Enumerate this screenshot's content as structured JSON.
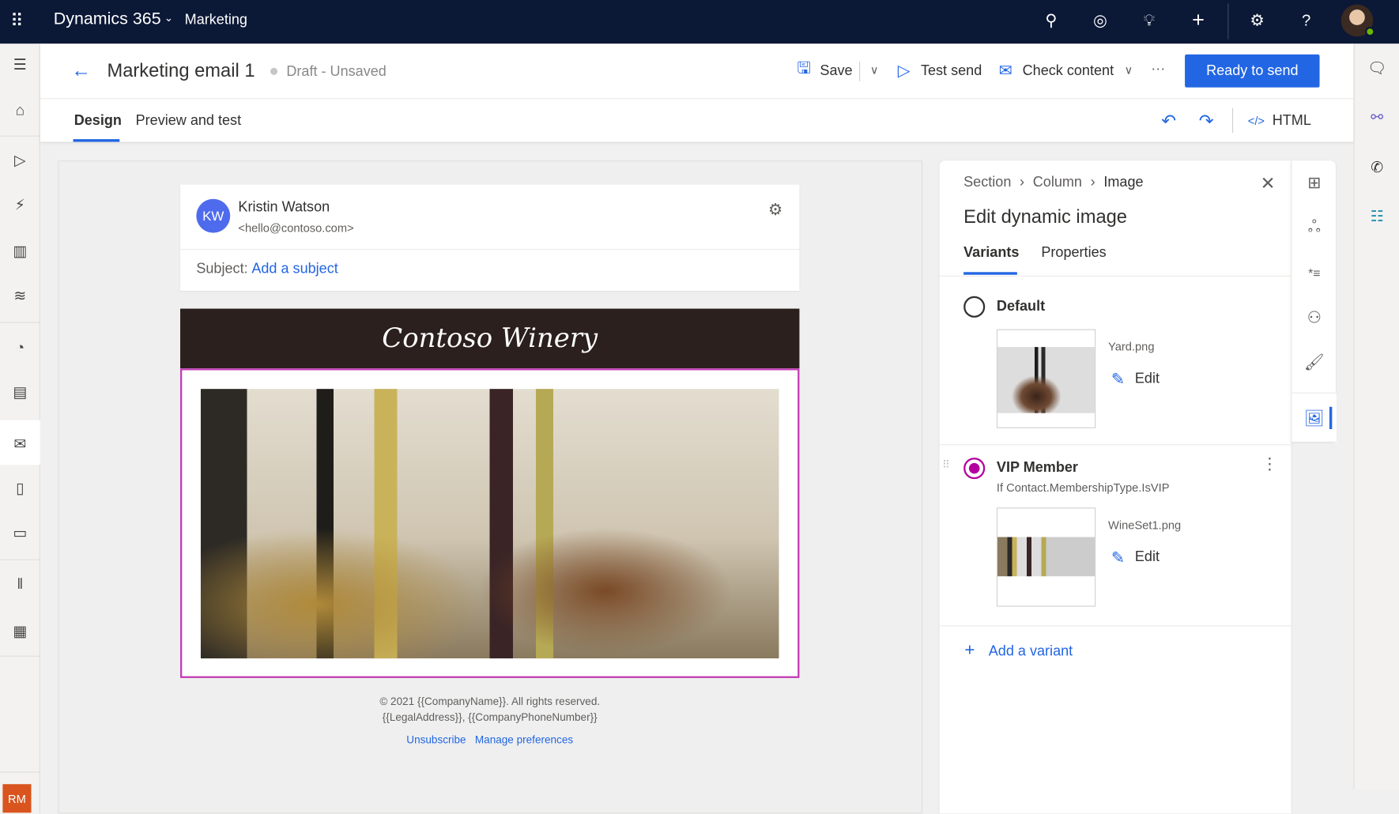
{
  "topbar": {
    "app_name": "Dynamics 365",
    "module": "Marketing"
  },
  "header": {
    "title": "Marketing email 1",
    "status": "Draft - Unsaved",
    "save": "Save",
    "test_send": "Test send",
    "check_content": "Check content",
    "more": "···",
    "ready": "Ready to send",
    "html": "HTML"
  },
  "tabs": [
    {
      "label": "Design",
      "active": true
    },
    {
      "label": "Preview and test",
      "active": false
    }
  ],
  "email": {
    "initials": "KW",
    "sender_name": "Kristin Watson",
    "sender_email": "<hello@contoso.com>",
    "subject_label": "Subject:",
    "subject_placeholder": "Add a subject",
    "brand": "Contoso Winery",
    "footer_line1": "© 2021 {{CompanyName}}. All rights reserved.",
    "footer_line2": "{{LegalAddress}}, {{CompanyPhoneNumber}}",
    "unsubscribe": "Unsubscribe",
    "manage": "Manage preferences"
  },
  "panel": {
    "breadcrumb": [
      "Section",
      "Column",
      "Image"
    ],
    "title": "Edit dynamic image",
    "tabs": [
      "Variants",
      "Properties"
    ],
    "variants": [
      {
        "name": "Default",
        "selected": false,
        "file": "Yard.png",
        "edit": "Edit"
      },
      {
        "name": "VIP Member",
        "selected": true,
        "condition": "If Contact.MembershipType.IsVIP",
        "file": "WineSet1.png",
        "edit": "Edit"
      }
    ],
    "add_variant": "Add a variant"
  },
  "user": {
    "initials": "RM"
  },
  "colors": {
    "accent": "#2266e3",
    "topbar": "#0b1836",
    "selected": "#b4009e"
  }
}
